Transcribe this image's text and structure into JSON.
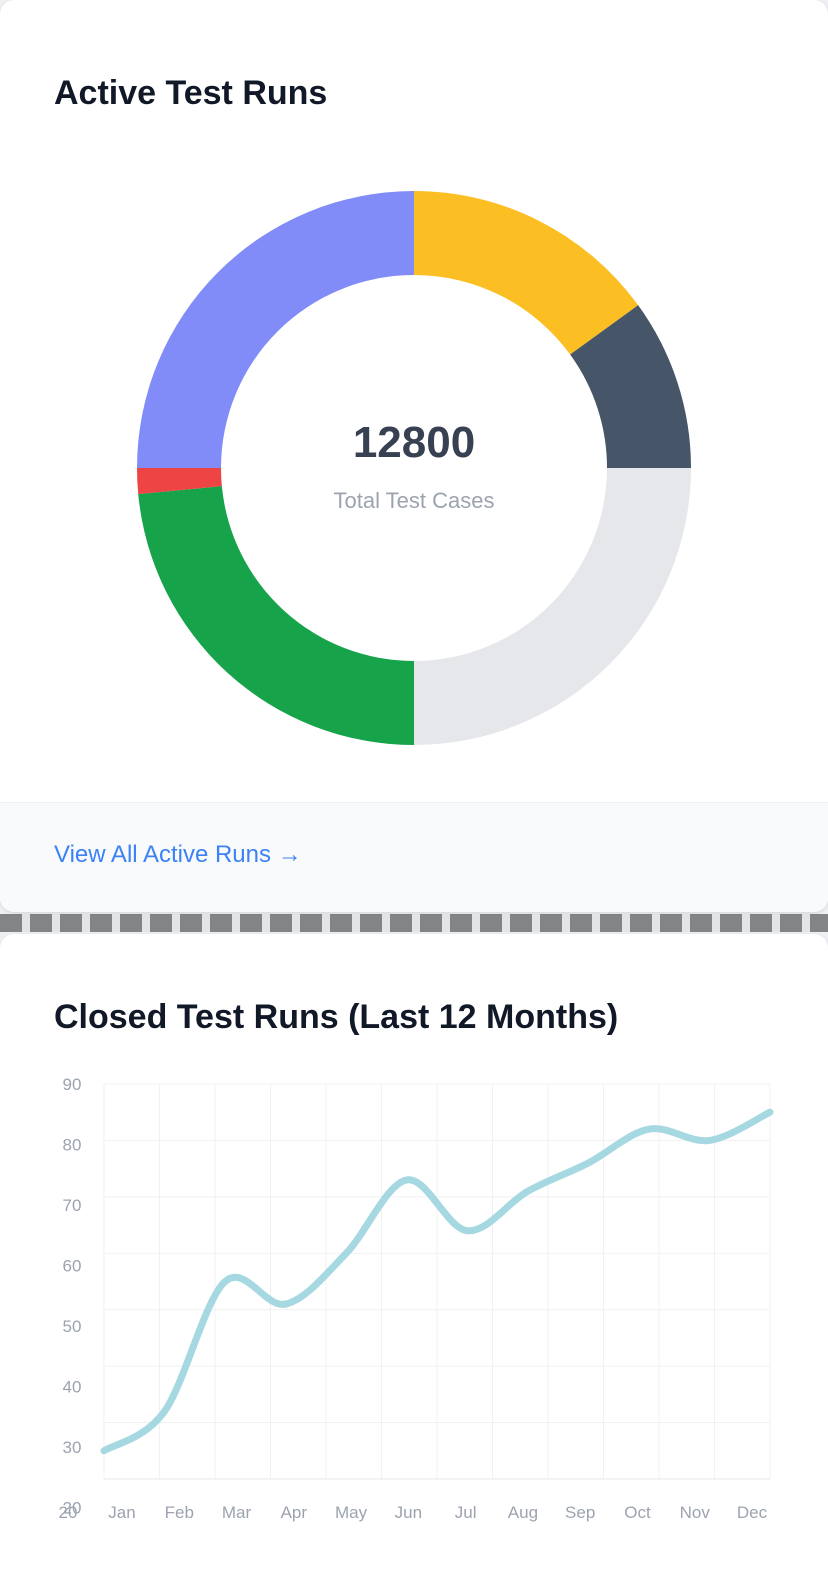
{
  "active_card": {
    "title": "Active Test Runs",
    "total_value": "12800",
    "total_label": "Total Test Cases",
    "footer_link": "View All Active Runs",
    "footer_arrow": "→"
  },
  "closed_card": {
    "title": "Closed Test Runs (Last 12 Months)"
  },
  "chart_data": [
    {
      "type": "pie",
      "variant": "donut",
      "title": "Active Test Runs",
      "center_text": "12800",
      "center_subtext": "Total Test Cases",
      "slices": [
        {
          "color": "#fbbf24",
          "value": 0.15
        },
        {
          "color": "#475569",
          "value": 0.1
        },
        {
          "color": "#e5e7eb",
          "value": 0.25
        },
        {
          "color": "#16a34a",
          "value": 0.235
        },
        {
          "color": "#ef4444",
          "value": 0.015
        },
        {
          "color": "#818cf8",
          "value": 0.25
        }
      ]
    },
    {
      "type": "line",
      "title": "Closed Test Runs (Last 12 Months)",
      "categories": [
        "Jan",
        "Feb",
        "Mar",
        "Apr",
        "May",
        "Jun",
        "Jul",
        "Aug",
        "Sep",
        "Oct",
        "Nov",
        "Dec"
      ],
      "x_axis_zero_label": "20",
      "y_ticks": [
        "20",
        "30",
        "40",
        "50",
        "60",
        "70",
        "80",
        "90"
      ],
      "ylim": [
        20,
        90
      ],
      "values": [
        25,
        32,
        55,
        51,
        60,
        73,
        64,
        71,
        76,
        82,
        80,
        85
      ],
      "line_color": "#a5d8e0",
      "grid": true
    }
  ]
}
